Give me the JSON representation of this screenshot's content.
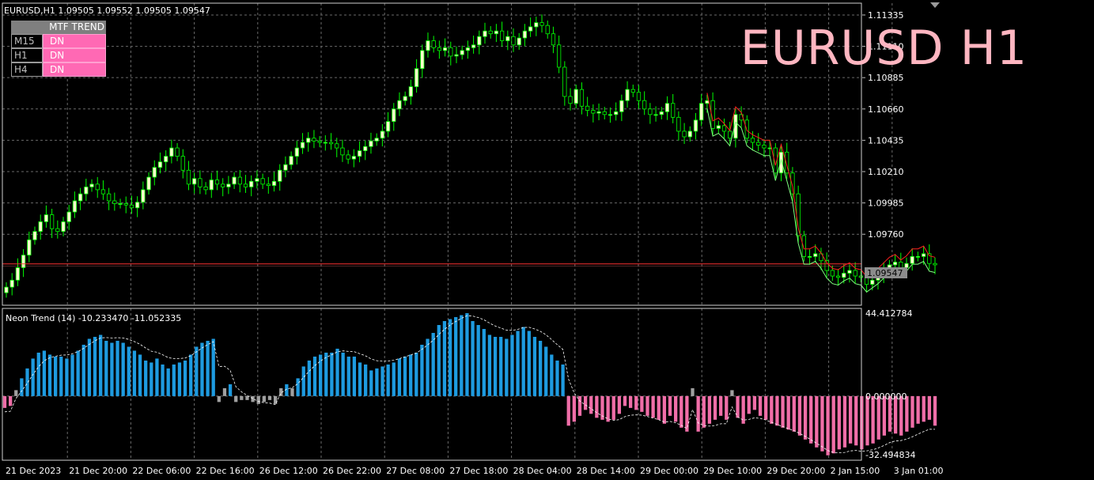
{
  "window": {
    "symbol_info": "EURUSD,H1  1.09505 1.09552 1.09505 1.09547",
    "big_title": "EURUSD H1",
    "current_price": "1.09547"
  },
  "mtf_panel": {
    "title": "MTF TREND",
    "rows": [
      {
        "tf": "M15",
        "dir": "DN"
      },
      {
        "tf": "H1",
        "dir": "DN"
      },
      {
        "tf": "H4",
        "dir": "DN"
      }
    ]
  },
  "indicator": {
    "label": "Neon Trend (14) -10.233470 -11.052335",
    "scale_top": "44.412784",
    "scale_zero": "0.000000",
    "scale_bottom": "-32.494834"
  },
  "colors": {
    "background": "#000000",
    "bull_candle": "#ffffcc",
    "candle_outline": "#00ff00",
    "bear_candle": "#000000",
    "price_line": "#ff3333",
    "hist_up": "#1e9be0",
    "hist_down": "#f06ea8",
    "hist_neutral": "#a0a0a0",
    "grid": "#6a6a6a"
  },
  "chart_data": [
    {
      "type": "candlestick",
      "title": "EURUSD,H1",
      "y_ticks": [
        "1.11335",
        "1.11110",
        "1.10885",
        "1.10660",
        "1.10435",
        "1.10210",
        "1.09985",
        "1.09760"
      ],
      "ylim": [
        1.0925,
        1.1142
      ],
      "x_ticks": [
        "21 Dec 2023",
        "21 Dec 20:00",
        "22 Dec 06:00",
        "22 Dec 16:00",
        "26 Dec 12:00",
        "26 Dec 22:00",
        "27 Dec 08:00",
        "27 Dec 18:00",
        "28 Dec 04:00",
        "28 Dec 14:00",
        "29 Dec 00:00",
        "29 Dec 10:00",
        "29 Dec 20:00",
        "2 Jan 15:00",
        "3 Jan 01:00"
      ],
      "grid": true,
      "current_price": 1.09547,
      "close": [
        1.0938,
        1.0943,
        1.0952,
        1.0961,
        1.0972,
        1.0978,
        1.0985,
        1.099,
        1.098,
        1.0978,
        1.0985,
        1.0992,
        1.1,
        1.1005,
        1.101,
        1.1012,
        1.1008,
        1.1005,
        1.1,
        1.0998,
        1.0998,
        1.0997,
        1.0995,
        1.0999,
        1.1008,
        1.1017,
        1.1024,
        1.1028,
        1.1032,
        1.1038,
        1.1032,
        1.1022,
        1.1012,
        1.1016,
        1.101,
        1.1008,
        1.1015,
        1.1012,
        1.101,
        1.1012,
        1.1017,
        1.1012,
        1.101,
        1.1014,
        1.1016,
        1.1012,
        1.1011,
        1.1014,
        1.1022,
        1.1026,
        1.1032,
        1.1038,
        1.1042,
        1.1045,
        1.1043,
        1.1042,
        1.1042,
        1.1041,
        1.1038,
        1.1033,
        1.103,
        1.1032,
        1.1036,
        1.1039,
        1.1043,
        1.1045,
        1.105,
        1.1057,
        1.1066,
        1.1072,
        1.1075,
        1.1082,
        1.1095,
        1.1108,
        1.1115,
        1.111,
        1.1108,
        1.111,
        1.1104,
        1.1105,
        1.1108,
        1.111,
        1.1112,
        1.1118,
        1.1122,
        1.112,
        1.1122,
        1.1115,
        1.1118,
        1.1112,
        1.1117,
        1.1122,
        1.1125,
        1.1128,
        1.1126,
        1.112,
        1.1112,
        1.1096,
        1.1075,
        1.107,
        1.108,
        1.1068,
        1.1065,
        1.1063,
        1.1064,
        1.1062,
        1.1062,
        1.1064,
        1.1072,
        1.108,
        1.1078,
        1.1072,
        1.1066,
        1.1062,
        1.1062,
        1.1064,
        1.107,
        1.106,
        1.105,
        1.1046,
        1.105,
        1.1058,
        1.107,
        1.1072,
        1.1052,
        1.1054,
        1.105,
        1.1045,
        1.1062,
        1.1058,
        1.1045,
        1.1042,
        1.104,
        1.1038,
        1.1038,
        1.102,
        1.1035,
        1.102,
        1.1005,
        1.0975,
        1.096,
        1.096,
        1.0962,
        1.0957,
        1.095,
        1.0946,
        1.0945,
        1.0948,
        1.095,
        1.0946,
        1.0945,
        1.094,
        1.0943,
        1.0946,
        1.095,
        1.0954,
        1.0956,
        1.0952,
        1.0955,
        1.096,
        1.096,
        1.0962,
        1.0955,
        1.0954
      ]
    },
    {
      "type": "histogram",
      "title": "Neon Trend (14)",
      "ylim": [
        -32.494834,
        44.412784
      ],
      "values": [
        -6,
        -5,
        3,
        9,
        14,
        19,
        22,
        23,
        21,
        20,
        20,
        19,
        21,
        23,
        26,
        29,
        30,
        31,
        28,
        27,
        28,
        27,
        25,
        23,
        21,
        18,
        17,
        19,
        16,
        14,
        16,
        17,
        18,
        21,
        25,
        27,
        28,
        29,
        -3,
        4,
        6,
        -3,
        -2,
        -2,
        -3,
        -4,
        -3,
        -2,
        -4,
        4,
        6,
        4,
        9,
        15,
        18,
        20,
        21,
        22,
        22,
        24,
        22,
        20,
        20,
        17,
        16,
        13,
        14,
        15,
        16,
        17,
        19,
        20,
        21,
        22,
        26,
        29,
        32,
        36,
        38,
        39,
        40,
        41,
        42,
        38,
        36,
        34,
        31,
        30,
        30,
        29,
        31,
        33,
        35,
        33,
        30,
        28,
        25,
        21,
        18,
        16,
        -15,
        -13,
        -10,
        -7,
        -9,
        -11,
        -12,
        -13,
        -12,
        -9,
        -5,
        -6,
        -7,
        -8,
        -10,
        -11,
        -12,
        -14,
        -10,
        -13,
        -16,
        -18,
        4,
        -18,
        -16,
        -14,
        -12,
        -10,
        -12,
        3,
        -11,
        -14,
        -9,
        -7,
        -10,
        -12,
        -14,
        -15,
        -16,
        -17,
        -18,
        -20,
        -22,
        -24,
        -26,
        -28,
        -30,
        -29,
        -27,
        -26,
        -24,
        -25,
        -27,
        -25,
        -24,
        -22,
        -20,
        -18,
        -19,
        -20,
        -18,
        -16,
        -14,
        -13,
        -12,
        -15
      ]
    }
  ]
}
